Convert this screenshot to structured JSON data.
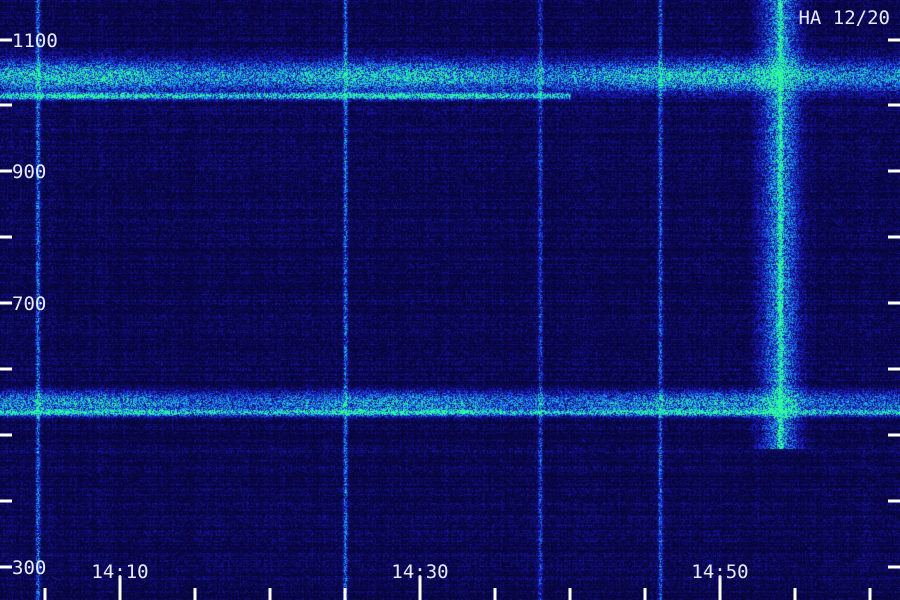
{
  "corner_label": "HA 12/20",
  "chart_data": {
    "type": "heatmap",
    "title": "",
    "xlabel": "",
    "ylabel": "",
    "xlim": [
      "14:02",
      "15:02"
    ],
    "ylim": [
      250,
      1160
    ],
    "x_tick_labels": [
      "14:10",
      "14:30",
      "14:50"
    ],
    "x_major_ticks": [
      "14:10",
      "14:30",
      "14:50"
    ],
    "x_minor_ticks": [
      "14:05",
      "14:15",
      "14:20",
      "14:25",
      "14:35",
      "14:40",
      "14:45",
      "14:55",
      "15:00"
    ],
    "y_tick_labels": [
      300,
      700,
      900,
      1100
    ],
    "y_label_text": [
      "300",
      "700",
      "900",
      "1100"
    ],
    "y_ticks": [
      300,
      400,
      500,
      600,
      700,
      800,
      900,
      1000,
      1100
    ],
    "colors": {
      "background": "#07063a",
      "low": "#1b17c8",
      "mid": "#1a9be6",
      "high": "#2dff9a"
    },
    "horizontal_bands": [
      {
        "center": 1045,
        "width": 55,
        "intensity": 0.8,
        "x_start": "14:02",
        "x_end": "15:02"
      },
      {
        "center": 1015,
        "width": 12,
        "intensity": 1.0,
        "x_start": "14:02",
        "x_end": "14:40"
      },
      {
        "center": 550,
        "width": 40,
        "intensity": 0.65,
        "x_start": "14:02",
        "x_end": "15:02"
      },
      {
        "center": 535,
        "width": 10,
        "intensity": 0.9,
        "x_start": "14:02",
        "x_end": "15:02"
      }
    ],
    "vertical_bursts": [
      {
        "time": "14:04.5",
        "y_from": 250,
        "y_to": 1160,
        "intensity": 0.55
      },
      {
        "time": "14:25",
        "y_from": 250,
        "y_to": 1160,
        "intensity": 0.5
      },
      {
        "time": "14:38",
        "y_from": 250,
        "y_to": 1160,
        "intensity": 0.35
      },
      {
        "time": "14:46",
        "y_from": 250,
        "y_to": 1160,
        "intensity": 0.45
      },
      {
        "time": "14:54",
        "y_from": 480,
        "y_to": 1160,
        "intensity": 0.9
      }
    ]
  }
}
